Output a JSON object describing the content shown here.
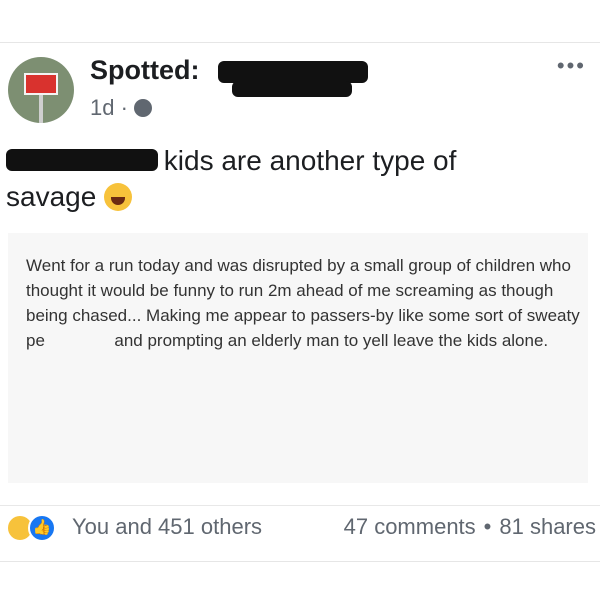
{
  "post": {
    "author": "Spotted:",
    "time": "1d ·",
    "more": "•••",
    "text_part1": "kids are another type of",
    "text_part2": "savage",
    "quote_part1": "Went for a run today and was disrupted by a small group of children who thought it would be funny to run 2m ahead of me screaming as though being chased... Making me appear to passers-by like some sort of sweaty pe",
    "quote_part2": "and prompting an elderly man to yell leave the kids alone."
  },
  "footer": {
    "reactions": "You and 451 others",
    "comments": "47 comments",
    "separator": "•",
    "shares": "81 shares"
  },
  "icons": {
    "avatar": "railway-sign-icon",
    "privacy": "globe-icon",
    "emoji": "laughing-emoji-icon",
    "haha": "haha-reaction-icon",
    "like": "like-reaction-icon"
  },
  "colors": {
    "like_blue": "#1877f2",
    "emoji_yellow": "#f7c23b",
    "muted_text": "#606770",
    "primary_text": "#1c1e21",
    "quote_background": "#f7f7f7"
  }
}
